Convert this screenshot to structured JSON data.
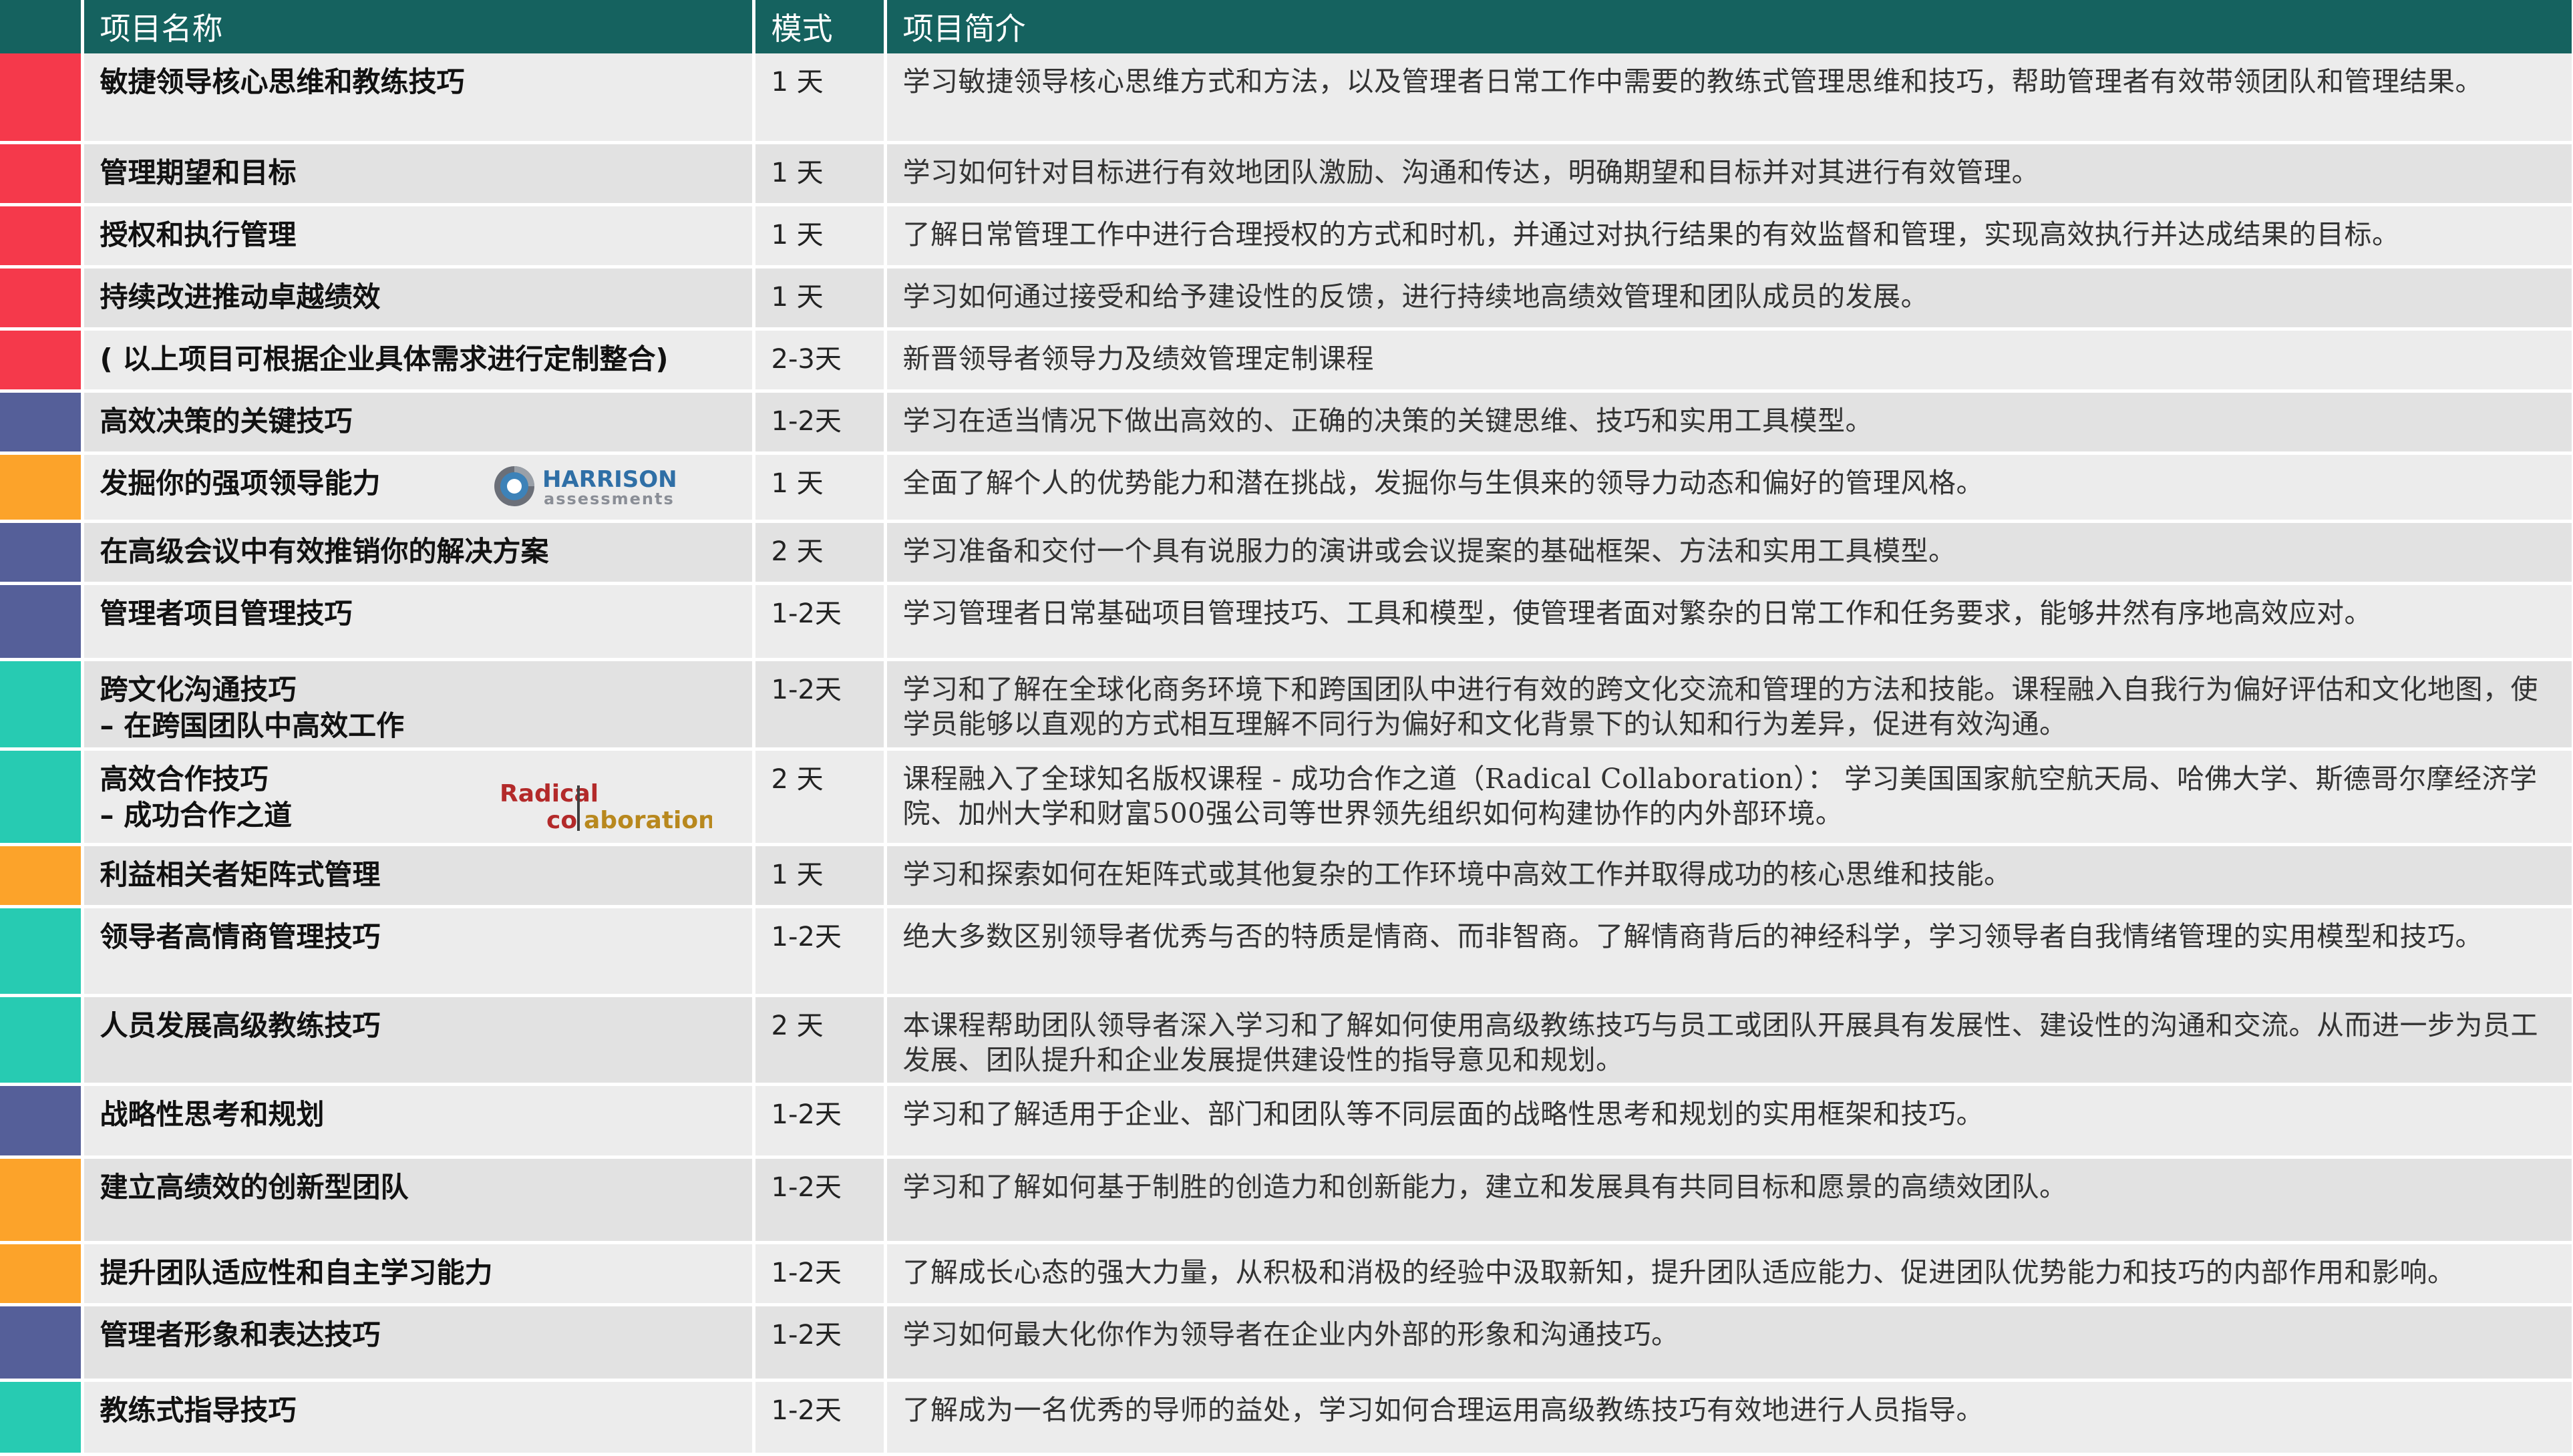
{
  "header": {
    "name": "项目名称",
    "mode": "模式",
    "description": "项目简介"
  },
  "colors": {
    "header_bg": "#15625f",
    "red": "#f5394b",
    "blue": "#555f99",
    "orange": "#fca32a",
    "teal": "#27cbb2"
  },
  "rows": [
    {
      "color": "red",
      "name": "敏捷领导核心思维和教练技巧",
      "subtitle": "",
      "mode": "1 天",
      "description": "学习敏捷领导核心思维方式和方法，以及管理者日常工作中需要的教练式管理思维和技巧，帮助管理者有效带领团队和管理结果。"
    },
    {
      "color": "red",
      "name": "管理期望和目标",
      "subtitle": "",
      "mode": "1 天",
      "description": "学习如何针对目标进行有效地团队激励、沟通和传达，明确期望和目标并对其进行有效管理。"
    },
    {
      "color": "red",
      "name": "授权和执行管理",
      "subtitle": "",
      "mode": "1 天",
      "description": "了解日常管理工作中进行合理授权的方式和时机，并通过对执行结果的有效监督和管理，实现高效执行并达成结果的目标。"
    },
    {
      "color": "red",
      "name": "持续改进推动卓越绩效",
      "subtitle": "",
      "mode": "1 天",
      "description": "学习如何通过接受和给予建设性的反馈，进行持续地高绩效管理和团队成员的发展。"
    },
    {
      "color": "red",
      "name": "( 以上项目可根据企业具体需求进行定制整合)",
      "subtitle": "",
      "mode": "2-3天",
      "description": " 新晋领导者领导力及绩效管理定制课程"
    },
    {
      "color": "blue",
      "name": "高效决策的关键技巧",
      "subtitle": "",
      "mode": "1-2天",
      "description": "学习在适当情况下做出高效的、正确的决策的关键思维、技巧和实用工具模型。"
    },
    {
      "color": "orange",
      "name": "发掘你的强项领导能力",
      "subtitle": "",
      "mode": "1 天",
      "description": "全面了解个人的优势能力和潜在挑战，发掘你与生俱来的领导力动态和偏好的管理风格。",
      "logo": "harrison"
    },
    {
      "color": "blue",
      "name": "在高级会议中有效推销你的解决方案",
      "subtitle": "",
      "mode": "2 天",
      "description": "学习准备和交付一个具有说服力的演讲或会议提案的基础框架、方法和实用工具模型。"
    },
    {
      "color": "blue",
      "name": "管理者项目管理技巧",
      "subtitle": "",
      "mode": "1-2天",
      "description": "学习管理者日常基础项目管理技巧、工具和模型，使管理者面对繁杂的日常工作和任务要求，能够井然有序地高效应对。"
    },
    {
      "color": "teal",
      "name": "跨文化沟通技巧",
      "subtitle": "– 在跨国团队中高效工作",
      "mode": "1-2天",
      "description": "学习和了解在全球化商务环境下和跨国团队中进行有效的跨文化交流和管理的方法和技能。课程融入自我行为偏好评估和文化地图，使学员能够以直观的方式相互理解不同行为偏好和文化背景下的认知和行为差异，促进有效沟通。"
    },
    {
      "color": "teal",
      "name": "高效合作技巧",
      "subtitle": "– 成功合作之道",
      "mode": "2 天",
      "description": "课程融入了全球知名版权课程 - 成功合作之道（Radical Collaboration）： 学习美国国家航空航天局、哈佛大学、斯德哥尔摩经济学院、加州大学和财富500强公司等世界领先组织如何构建协作的内外部环境。",
      "logo": "radical"
    },
    {
      "color": "orange",
      "name": "利益相关者矩阵式管理",
      "subtitle": "",
      "mode": "1 天",
      "description": "学习和探索如何在矩阵式或其他复杂的工作环境中高效工作并取得成功的核心思维和技能。"
    },
    {
      "color": "teal",
      "name": "领导者高情商管理技巧",
      "subtitle": "",
      "mode": "1-2天",
      "description": "绝大多数区别领导者优秀与否的特质是情商、而非智商。了解情商背后的神经科学，学习领导者自我情绪管理的实用模型和技巧。"
    },
    {
      "color": "teal",
      "name": "人员发展高级教练技巧",
      "subtitle": "",
      "mode": "2 天",
      "description": "本课程帮助团队领导者深入学习和了解如何使用高级教练技巧与员工或团队开展具有发展性、建设性的沟通和交流。从而进一步为员工发展、团队提升和企业发展提供建设性的指导意见和规划。"
    },
    {
      "color": "blue",
      "name": "战略性思考和规划",
      "subtitle": "",
      "mode": "1-2天",
      "description": "学习和了解适用于企业、部门和团队等不同层面的战略性思考和规划的实用框架和技巧。"
    },
    {
      "color": "orange",
      "name": "建立高绩效的创新型团队",
      "subtitle": "",
      "mode": "1-2天",
      "description": "学习和了解如何基于制胜的创造力和创新能力，建立和发展具有共同目标和愿景的高绩效团队。"
    },
    {
      "color": "orange",
      "name": "提升团队适应性和自主学习能力",
      "subtitle": "",
      "mode": "1-2天",
      "description": "了解成长心态的强大力量，从积极和消极的经验中汲取新知，提升团队适应能力、促进团队优势能力和技巧的内部作用和影响。"
    },
    {
      "color": "blue",
      "name": "管理者形象和表达技巧",
      "subtitle": "",
      "mode": "1-2天",
      "description": "学习如何最大化你作为领导者在企业内外部的形象和沟通技巧。"
    },
    {
      "color": "teal",
      "name": "教练式指导技巧",
      "subtitle": "",
      "mode": "1-2天",
      "description": "了解成为一名优秀的导师的益处，学习如何合理运用高级教练技巧有效地进行人员指导。"
    }
  ],
  "logos": {
    "harrison": {
      "title": "HARRISON",
      "subtitle": "assessments"
    },
    "radical": {
      "line1": "Radical",
      "line2_a": "co",
      "line2_b": "aboration"
    }
  }
}
